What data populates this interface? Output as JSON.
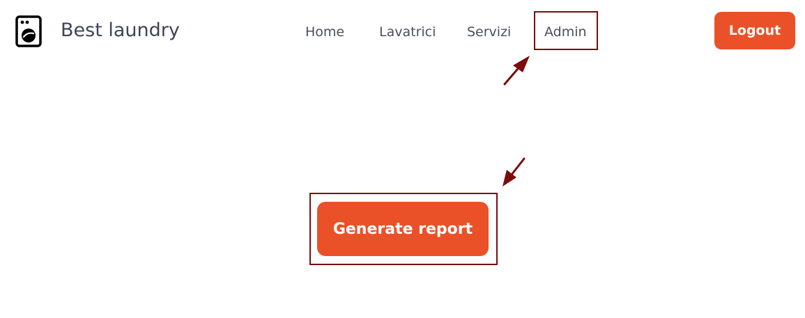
{
  "header": {
    "brand_title": "Best laundry",
    "brand_icon": "washing-machine-icon",
    "nav": {
      "home": "Home",
      "lavatrici": "Lavatrici",
      "servizi": "Servizi",
      "admin": "Admin"
    },
    "logout_label": "Logout"
  },
  "main": {
    "generate_report_label": "Generate report"
  },
  "colors": {
    "accent": "#ea5128",
    "annotation": "#7a0c0c",
    "text": "#3f4556"
  },
  "annotations": {
    "highlighted_items": [
      "admin-nav-link",
      "generate-report-button"
    ],
    "marker_icon": "arrow-icon"
  }
}
